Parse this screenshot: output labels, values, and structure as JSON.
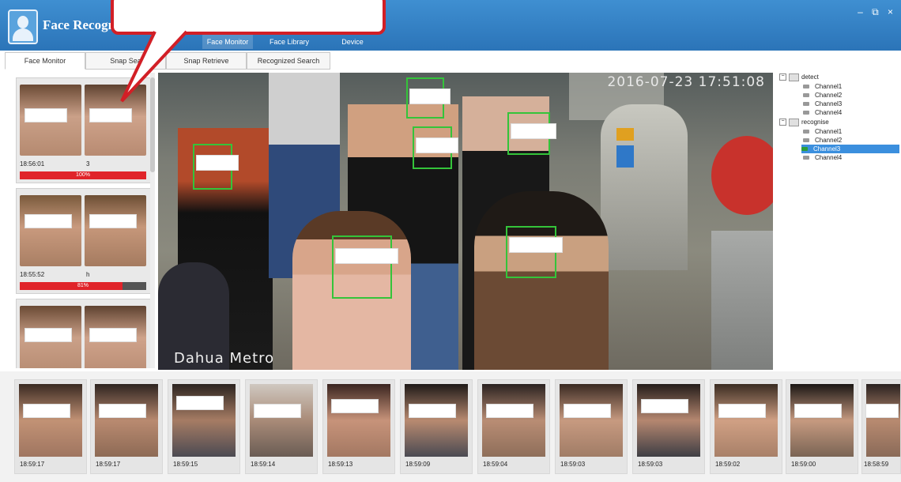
{
  "header": {
    "app_title": "Face Recognition",
    "nav": [
      {
        "label": "Face Monitor",
        "icon": "face-monitor-icon"
      },
      {
        "label": "Face Library",
        "icon": "face-library-icon"
      },
      {
        "label": "Device",
        "icon": "device-icon"
      }
    ],
    "window_controls": "– ⧉ ×"
  },
  "tabs": [
    "Face Monitor",
    "Snap Sea",
    "Snap Retrieve",
    "Recognized Search"
  ],
  "left_snaps": [
    {
      "time": "18:56:01",
      "name": "3",
      "percent_label": "100%",
      "percent": 1.0
    },
    {
      "time": "18:55:52",
      "name": "h",
      "percent_label": "81%",
      "percent": 0.81
    },
    {
      "time": "",
      "name": "",
      "percent_label": "",
      "percent": 0
    }
  ],
  "video": {
    "timestamp": "2016-07-23 17:51:08",
    "camera_label": "Dahua Metro"
  },
  "tree": {
    "groups": [
      {
        "label": "detect",
        "channels": [
          "Channel1",
          "Channel2",
          "Channel3",
          "Channel4"
        ]
      },
      {
        "label": "recognise",
        "channels": [
          "Channel1",
          "Channel2",
          "Channel3",
          "Channel4"
        ]
      }
    ],
    "selected": "recognise/Channel3"
  },
  "strip_times": [
    "18:59:17",
    "18:59:17",
    "18:59:15",
    "18:59:14",
    "18:59:13",
    "18:59:09",
    "18:59:04",
    "18:59:03",
    "18:59:03",
    "18:59:02",
    "18:59:00",
    "18:58:59"
  ],
  "colors": {
    "header": "#2f7fc4",
    "detect_box": "#34c43a",
    "bar_fill": "#e0242a",
    "callout": "#d21f26",
    "selection": "#3b8fde"
  }
}
